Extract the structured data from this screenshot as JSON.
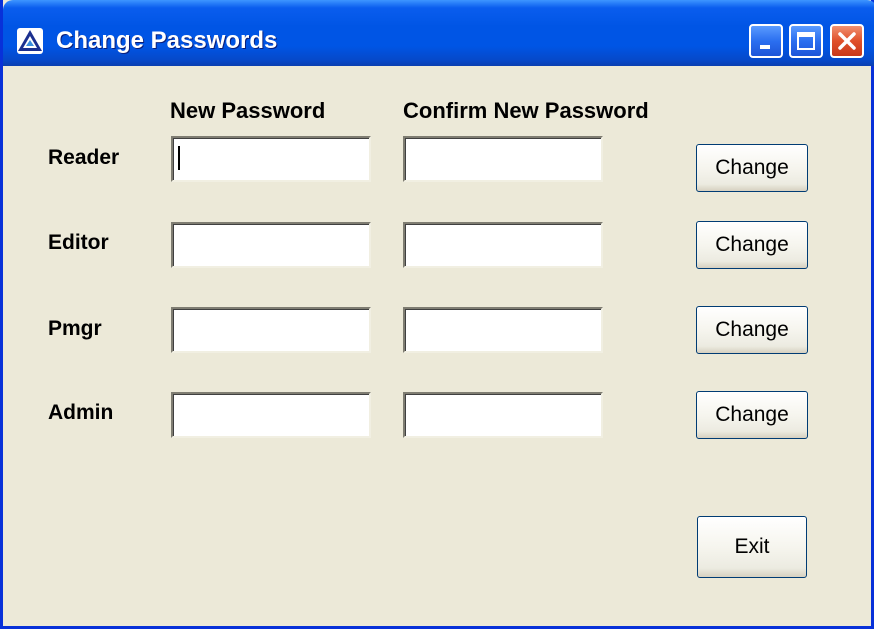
{
  "window": {
    "title": "Change Passwords",
    "icon": "app-icon",
    "controls": [
      "minimize-icon",
      "maximize-icon",
      "close-icon"
    ]
  },
  "headers": {
    "new_password": "New Password",
    "confirm_new_password": "Confirm New Password"
  },
  "rows": [
    {
      "label": "Reader",
      "new_value": "",
      "confirm_value": "",
      "button": "Change",
      "focused": true
    },
    {
      "label": "Editor",
      "new_value": "",
      "confirm_value": "",
      "button": "Change"
    },
    {
      "label": "Pmgr",
      "new_value": "",
      "confirm_value": "",
      "button": "Change"
    },
    {
      "label": "Admin",
      "new_value": "",
      "confirm_value": "",
      "button": "Change"
    }
  ],
  "exit_button": "Exit",
  "colors": {
    "titlebar": "#0055E5",
    "window_border": "#0831D9",
    "client_bg": "#ECE9D8",
    "close_button": "#E0502A"
  }
}
